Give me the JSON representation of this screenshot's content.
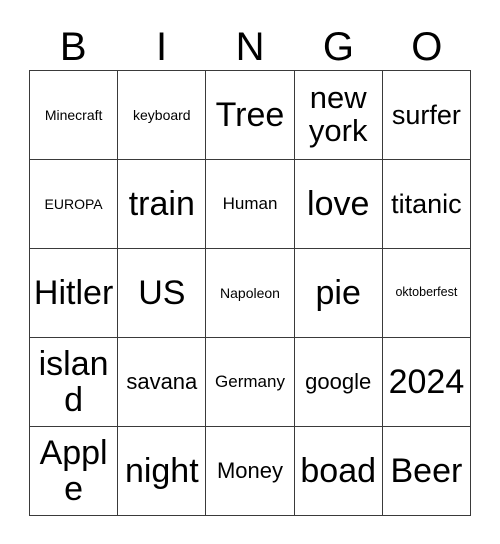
{
  "card": {
    "title": "BINGO",
    "columns": [
      "B",
      "I",
      "N",
      "G",
      "O"
    ],
    "rows": [
      {
        "cells": [
          {
            "text": "Minecraft",
            "size": "fs-xs"
          },
          {
            "text": "keyboard",
            "size": "fs-xs"
          },
          {
            "text": "Tree",
            "size": "fs-xxl"
          },
          {
            "text": "new york",
            "size": "fs-xl"
          },
          {
            "text": "surfer",
            "size": "fs-l"
          }
        ]
      },
      {
        "cells": [
          {
            "text": "EUROPA",
            "size": "fs-xs"
          },
          {
            "text": "train",
            "size": "fs-xxl"
          },
          {
            "text": "Human",
            "size": "fs-s"
          },
          {
            "text": "love",
            "size": "fs-xxl"
          },
          {
            "text": "titanic",
            "size": "fs-l"
          }
        ]
      },
      {
        "cells": [
          {
            "text": "Hitler",
            "size": "fs-xxl"
          },
          {
            "text": "US",
            "size": "fs-xxl"
          },
          {
            "text": "Napoleon",
            "size": "fs-xs"
          },
          {
            "text": "pie",
            "size": "fs-xxl"
          },
          {
            "text": "oktoberfest",
            "size": "fs-xxs"
          }
        ]
      },
      {
        "cells": [
          {
            "text": "island",
            "size": "fs-xxl"
          },
          {
            "text": "savana",
            "size": "fs-m"
          },
          {
            "text": "Germany",
            "size": "fs-s"
          },
          {
            "text": "google",
            "size": "fs-m"
          },
          {
            "text": "2024",
            "size": "fs-xxl"
          }
        ]
      },
      {
        "cells": [
          {
            "text": "Apple",
            "size": "fs-xxl"
          },
          {
            "text": "night",
            "size": "fs-xxl"
          },
          {
            "text": "Money",
            "size": "fs-m"
          },
          {
            "text": "boad",
            "size": "fs-xxl"
          },
          {
            "text": "Beer",
            "size": "fs-xxl"
          }
        ]
      }
    ]
  },
  "colors": {
    "text": "#000000",
    "border": "#3a3a3a",
    "background": "#ffffff"
  }
}
